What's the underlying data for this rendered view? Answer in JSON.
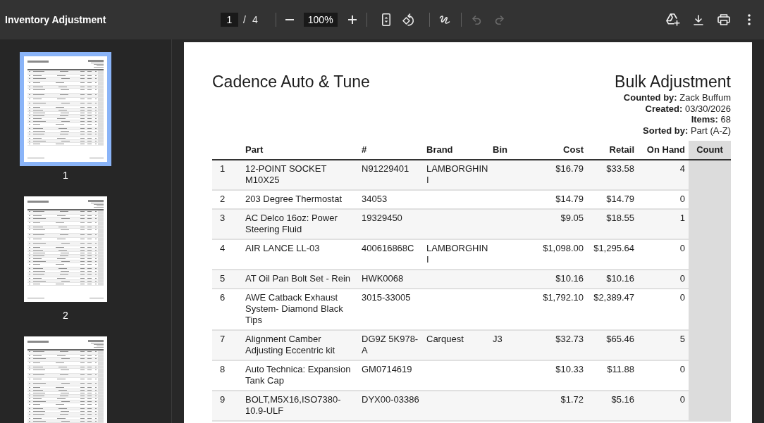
{
  "toolbar": {
    "title": "Inventory Adjustment",
    "page_input": {
      "value": "1"
    },
    "page_separator": "/",
    "page_total": "4",
    "zoom_input": {
      "value": "100%"
    },
    "tool_groups": [
      [
        {
          "kind": "fit",
          "disabled": false
        },
        {
          "kind": "rotate",
          "disabled": false
        }
      ],
      [
        {
          "kind": "draw",
          "disabled": false
        }
      ],
      [
        {
          "kind": "undo",
          "disabled": true
        },
        {
          "kind": "redo",
          "disabled": true
        }
      ]
    ],
    "actions": [
      {
        "kind": "upload"
      },
      {
        "kind": "download"
      },
      {
        "kind": "print"
      },
      {
        "kind": "more"
      }
    ]
  },
  "sidebar": {
    "thumbnails": [
      {
        "label": "1",
        "selected": true
      },
      {
        "label": "2",
        "selected": false
      },
      {
        "selected": false
      }
    ]
  },
  "document": {
    "company": "Cadence Auto & Tune",
    "title": "Bulk Adjustment",
    "meta": [
      "**Counted by:** Zack Buffum",
      "**Created:** 03/30/2026",
      "**Items:** 68",
      "**Sorted by:** Part (A-Z)"
    ],
    "table": {
      "columns": [
        "Part",
        "#",
        "Brand",
        "Bin",
        "Cost",
        "Retail",
        "On Hand",
        "Count"
      ],
      "rows": [
        {
          "number": "1",
          "part": "12-POINT SOCKET M10X25",
          "part_number": "N91229401",
          "brand": "LAMBORGHINI",
          "cost": "$16.79",
          "retail": "$33.58",
          "on_hand": "4"
        },
        {
          "number": "2",
          "part": "203 Degree Thermostat",
          "part_number": "34053",
          "cost": "$14.79",
          "retail": "$14.79",
          "on_hand": "0"
        },
        {
          "number": "3",
          "part": "AC Delco 16oz: Power Steering Fluid",
          "part_number": "19329450",
          "cost": "$9.05",
          "retail": "$18.55",
          "on_hand": "1"
        },
        {
          "number": "4",
          "part": "AIR LANCE LL-03",
          "part_number": "400616868C",
          "brand": "LAMBORGHINI",
          "cost": "$1,098.00",
          "retail": "$1,295.64",
          "on_hand": "0"
        },
        {
          "number": "5",
          "part": "AT Oil Pan Bolt Set - Rein",
          "part_number": "HWK0068",
          "cost": "$10.16",
          "retail": "$10.16",
          "on_hand": "0"
        },
        {
          "number": "6",
          "part": "AWE Catback Exhaust System- Diamond Black Tips",
          "part_number": "3015-33005",
          "cost": "$1,792.10",
          "retail": "$2,389.47",
          "on_hand": "0"
        },
        {
          "number": "7",
          "part": "Alignment Camber Adjusting Eccentric kit",
          "part_number": "DG9Z 5K978-A",
          "brand": "Carquest",
          "bin": "J3",
          "cost": "$32.73",
          "retail": "$65.46",
          "on_hand": "5"
        },
        {
          "number": "8",
          "part": "Auto Technica: Expansion Tank Cap",
          "part_number": "GM0714619",
          "cost": "$10.33",
          "retail": "$11.88",
          "on_hand": "0"
        },
        {
          "number": "9",
          "part": "BOLT,M5X16,ISO7380-10.9-ULF",
          "part_number": "DYX00-03386",
          "cost": "$1.72",
          "retail": "$5.16",
          "on_hand": "0"
        }
      ]
    }
  }
}
